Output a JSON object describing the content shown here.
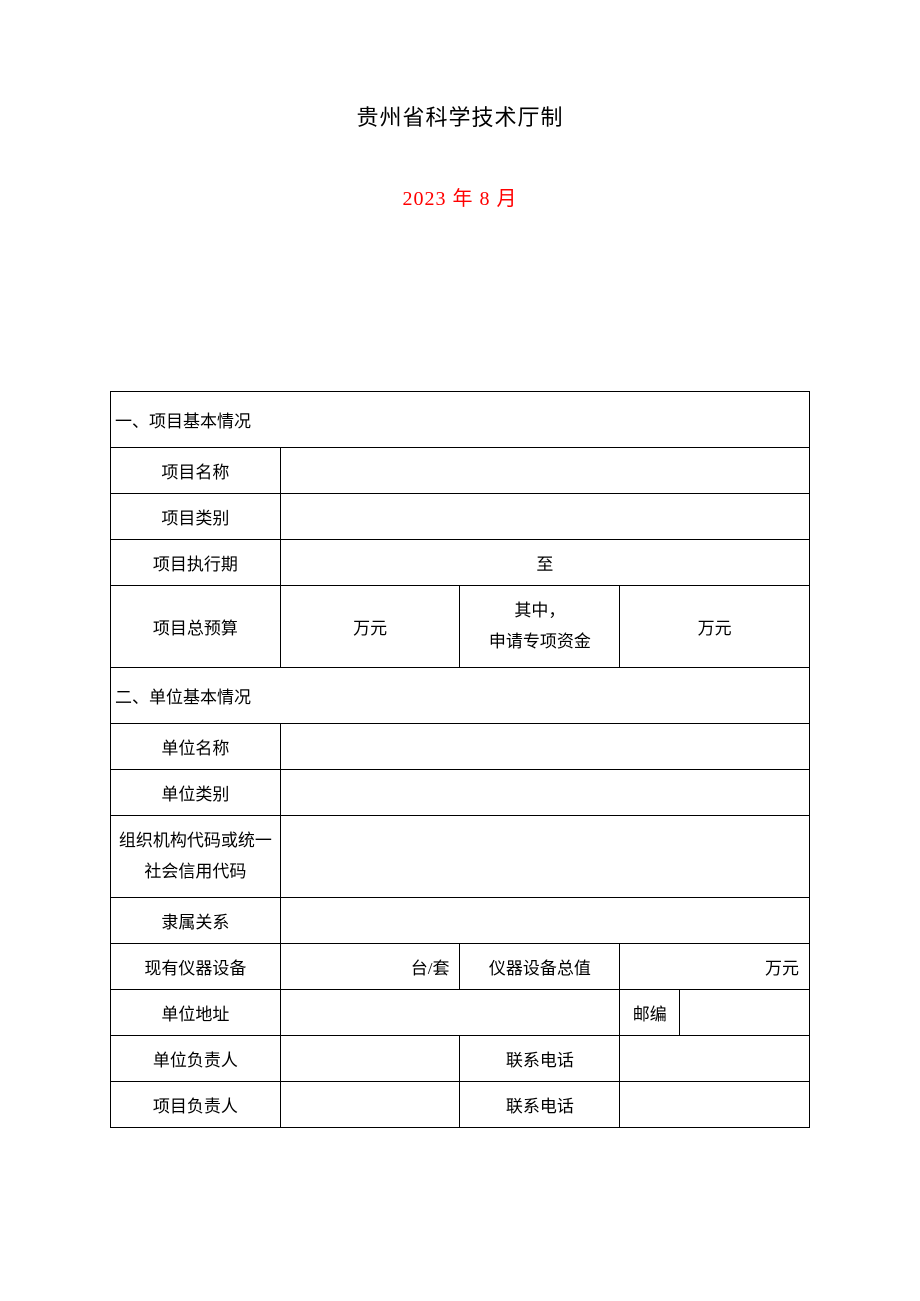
{
  "header": {
    "title": "贵州省科学技术厅制",
    "date": "2023 年 8 月"
  },
  "sections": {
    "s1": {
      "title": "一、项目基本情况",
      "project_name_label": "项目名称",
      "project_name_value": "",
      "project_category_label": "项目类别",
      "project_category_value": "",
      "project_period_label": "项目执行期",
      "project_period_value": "至",
      "total_budget_label": "项目总预算",
      "total_budget_unit": "万元",
      "special_fund_label": "其中，\n申请专项资金",
      "special_fund_unit": "万元"
    },
    "s2": {
      "title": "二、单位基本情况",
      "unit_name_label": "单位名称",
      "unit_name_value": "",
      "unit_category_label": "单位类别",
      "unit_category_value": "",
      "org_code_label": "组织机构代码或统一社会信用代码",
      "org_code_value": "",
      "affiliation_label": "隶属关系",
      "affiliation_value": "",
      "equipment_label": "现有仪器设备",
      "equipment_unit": "台/套",
      "equipment_total_label": "仪器设备总值",
      "equipment_total_unit": "万元",
      "address_label": "单位地址",
      "address_value": "",
      "postcode_label": "邮编",
      "postcode_value": "",
      "unit_leader_label": "单位负责人",
      "unit_leader_value": "",
      "unit_leader_phone_label": "联系电话",
      "unit_leader_phone_value": "",
      "project_leader_label": "项目负责人",
      "project_leader_value": "",
      "project_leader_phone_label": "联系电话",
      "project_leader_phone_value": ""
    }
  }
}
